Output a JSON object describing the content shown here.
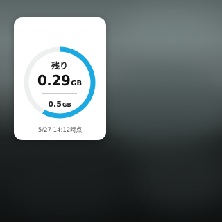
{
  "background": {
    "type": "blurred-wallpaper"
  },
  "widget": {
    "title": "残り",
    "remaining_value": "0.29",
    "remaining_unit": "GB",
    "total_value": "0.5",
    "total_unit": "GB",
    "timestamp": "5/27 14:12時点",
    "remaining_fraction": 0.58,
    "colors": {
      "accent": "#1ba9e1",
      "track": "#eef0f0",
      "card": "#ffffff"
    }
  }
}
